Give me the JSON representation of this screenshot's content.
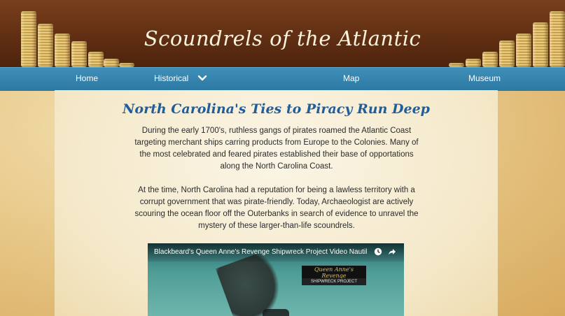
{
  "header": {
    "title": "Scoundrels of the Atlantic"
  },
  "nav": {
    "items": [
      {
        "label": "Home"
      },
      {
        "label": "Historical"
      },
      {
        "label": "Map"
      },
      {
        "label": "Museum"
      }
    ]
  },
  "main": {
    "headline": "North Carolina's Ties to Piracy Run Deep",
    "paragraphs": [
      "During the early 1700's, ruthless gangs of pirates roamed the Atlantic Coast targeting merchant ships carring products from Europe to the Colonies. Many of the most celebrated and feared pirates established their base of opportations along the North Carolina Coast.",
      "At the time, North Carolina had a reputation for being a lawless territory with a corrupt government that was pirate-friendly. Today, Archaeologist are actively scouring the ocean floor off the Outerbanks in search of evidence to unravel the mystery of these larger-than-life scoundrels."
    ],
    "video": {
      "title": "Blackbeard's Queen Anne's Revenge Shipwreck Project Video Nautil...",
      "overlay_logo": "Queen Anne's Revenge",
      "overlay_logo_sub": "SHIPWRECK PROJECT",
      "icons": [
        "watch-later-icon",
        "share-icon"
      ]
    }
  },
  "colors": {
    "header_bg": "#5e2d12",
    "nav_bg": "#2c79a3",
    "headline": "#1f5d9c",
    "body_text": "#2b2b2b"
  }
}
